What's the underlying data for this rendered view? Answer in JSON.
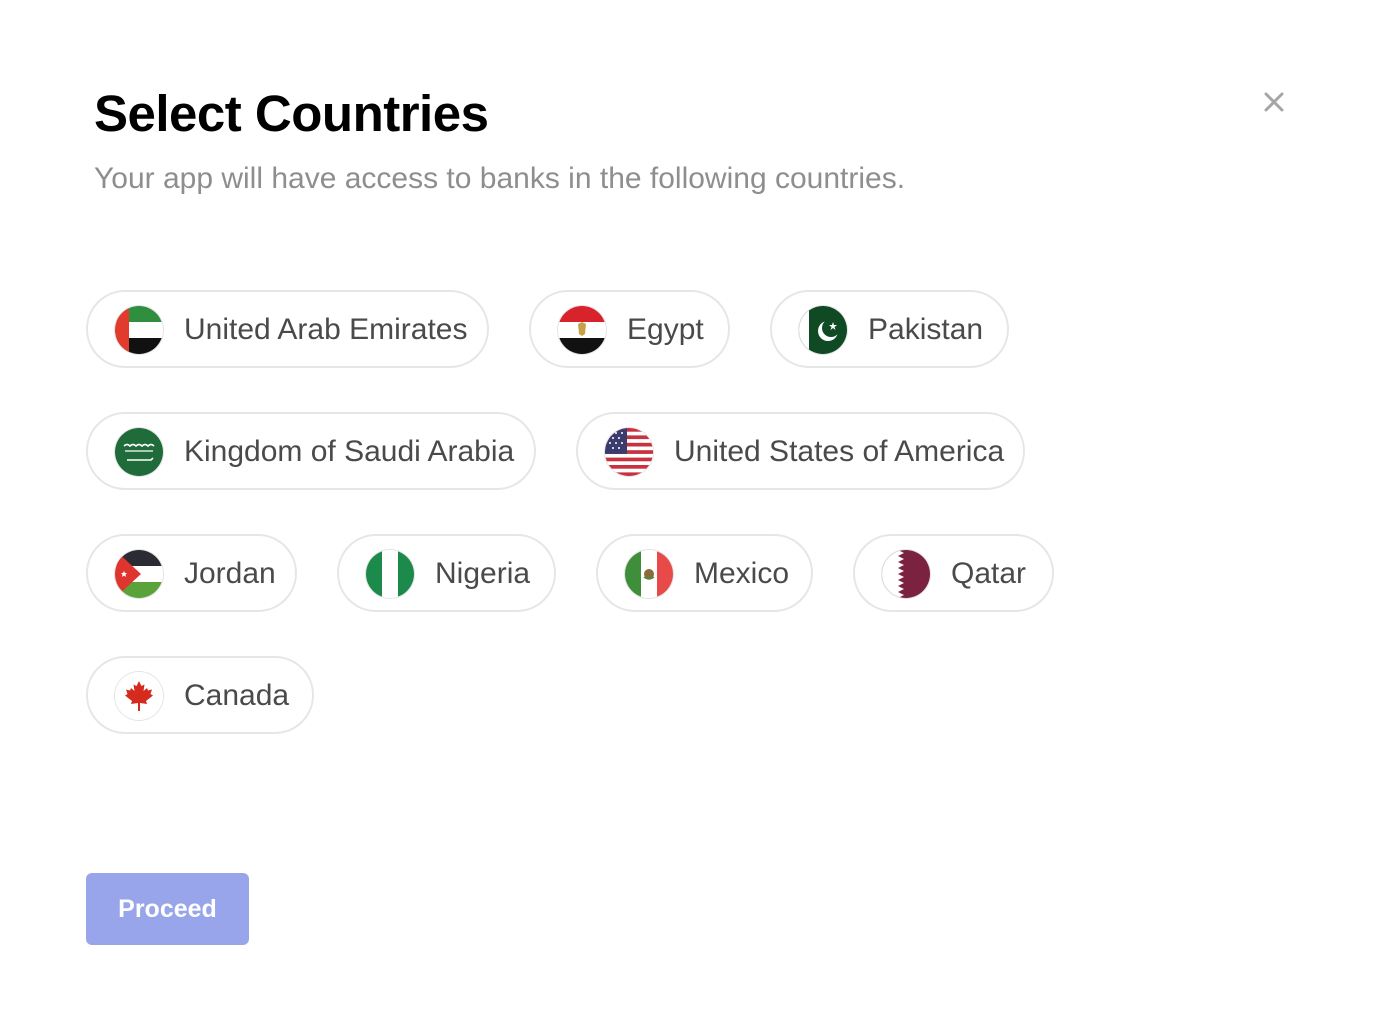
{
  "header": {
    "title": "Select Countries",
    "subtitle": "Your app will have access to banks in the following countries."
  },
  "close_icon": "close-icon",
  "countries": [
    {
      "label": "United Arab Emirates",
      "flag_icon": "uae-flag-icon"
    },
    {
      "label": "Egypt",
      "flag_icon": "egypt-flag-icon"
    },
    {
      "label": "Pakistan",
      "flag_icon": "pakistan-flag-icon"
    },
    {
      "label": "Kingdom of Saudi Arabia",
      "flag_icon": "saudi-arabia-flag-icon"
    },
    {
      "label": "United States of America",
      "flag_icon": "usa-flag-icon"
    },
    {
      "label": "Jordan",
      "flag_icon": "jordan-flag-icon"
    },
    {
      "label": "Nigeria",
      "flag_icon": "nigeria-flag-icon"
    },
    {
      "label": "Mexico",
      "flag_icon": "mexico-flag-icon"
    },
    {
      "label": "Qatar",
      "flag_icon": "qatar-flag-icon"
    },
    {
      "label": "Canada",
      "flag_icon": "canada-flag-icon"
    }
  ],
  "footer": {
    "proceed_label": "Proceed"
  },
  "colors": {
    "title": "#000000",
    "subtitle": "#8e8e8e",
    "chip_border": "#e6e6e6",
    "chip_text": "#4a4a4a",
    "proceed_bg": "#99a5eb",
    "proceed_text": "#ffffff"
  }
}
